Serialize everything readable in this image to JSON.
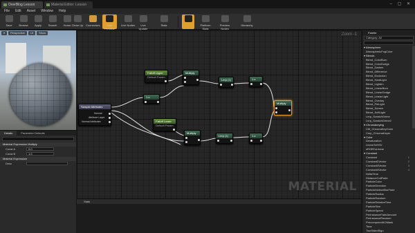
{
  "tabs": [
    {
      "label": "OverBlog Lesson"
    },
    {
      "label": "Material Editor: Lesson"
    }
  ],
  "menu": [
    "File",
    "Edit",
    "Asset",
    "Window",
    "Help"
  ],
  "toolbar": [
    {
      "label": "Save",
      "icon": "save-icon"
    },
    {
      "label": "Browse",
      "icon": "browse-icon"
    },
    {
      "label": "Apply",
      "icon": "apply-icon"
    },
    {
      "label": "Search",
      "icon": "search-icon"
    },
    {
      "label": "Home",
      "icon": "home-icon"
    },
    {
      "label": "Clean Up",
      "icon": "clean-up-icon"
    },
    {
      "label": "Connectors",
      "icon": "connectors-icon"
    },
    {
      "label": "Live Preview",
      "icon": "live-preview-icon"
    },
    {
      "label": "Live Nodes",
      "icon": "live-nodes-icon"
    },
    {
      "label": "Live Update",
      "icon": "live-update-icon"
    },
    {
      "label": "Stats",
      "icon": "stats-icon"
    },
    {
      "label": "Platform Stats",
      "icon": "platform-stats-icon"
    },
    {
      "label": "Preview Nodes",
      "icon": "preview-nodes-icon"
    },
    {
      "label": "Hierarchy",
      "icon": "hierarchy-icon"
    }
  ],
  "viewport": {
    "buttons": [
      "Perspective",
      "Lit",
      "Show"
    ]
  },
  "details": {
    "tabs": [
      "Details",
      "Parameter Defaults"
    ],
    "sections": [
      {
        "title": "Material Expression Multiply",
        "rows": [
          {
            "label": "Const A",
            "value": "0.0"
          },
          {
            "label": "Const B",
            "value": "1.0"
          }
        ]
      },
      {
        "title": "Material Expression",
        "rows": [
          {
            "label": "Desc",
            "value": ""
          }
        ]
      }
    ]
  },
  "graph": {
    "zoom": "Zoom -1",
    "watermark": "MATERIAL",
    "nodes": {
      "texcoord": {
        "title": "Sample Attributes",
        "pins": [
          "Normal",
          "Attribute Layer",
          "Normal Attributes"
        ]
      },
      "falloff_upper": {
        "title": "Falloff Upper",
        "sub": "Default Param"
      },
      "falloff_lower": {
        "title": "Falloff Lower",
        "sub": "Default Param"
      },
      "mult1": {
        "title": "Multiply"
      },
      "mult2": {
        "title": "Multiply"
      },
      "power1": {
        "title": "Lerp (1)"
      },
      "power2": {
        "title": "Lerp (1)"
      },
      "clamp1": {
        "title": "1-x"
      },
      "clamp2": {
        "title": "1-x"
      },
      "comp": {
        "title": "1-x"
      },
      "final": {
        "title": "Multiply"
      }
    }
  },
  "stats": {
    "title": "Stats"
  },
  "palette": {
    "tab": "Palette",
    "category": "Category: All",
    "items": [
      {
        "label": "Atmosphere",
        "cat": true
      },
      {
        "label": "AtmosphericFogColor"
      },
      {
        "label": "Blends",
        "cat": true
      },
      {
        "label": "Blend_ColorBurn"
      },
      {
        "label": "Blend_ColorDodge"
      },
      {
        "label": "Blend_Darken"
      },
      {
        "label": "Blend_Difference"
      },
      {
        "label": "Blend_Exclusion"
      },
      {
        "label": "Blend_HardLight"
      },
      {
        "label": "Blend_Lighten"
      },
      {
        "label": "Blend_LinearBurn"
      },
      {
        "label": "Blend_LinearDodge"
      },
      {
        "label": "Blend_LinearLight"
      },
      {
        "label": "Blend_Overlay"
      },
      {
        "label": "Blend_PinLight"
      },
      {
        "label": "Blend_Screen"
      },
      {
        "label": "Blend_SoftLight"
      },
      {
        "label": "Lerp_ScratchGrime"
      },
      {
        "label": "Lerp_ScratchGrime2"
      },
      {
        "label": "Chromakeying",
        "cat": true
      },
      {
        "label": "CM_ChromaKeyColor"
      },
      {
        "label": "Cmp_ChromaKeyer"
      },
      {
        "label": "Color",
        "cat": true
      },
      {
        "label": "Desaturation"
      },
      {
        "label": "LinearToHSV"
      },
      {
        "label": "sRGBToLinear"
      },
      {
        "label": "Constant",
        "cat": true
      },
      {
        "label": "Constant",
        "hk": "1"
      },
      {
        "label": "Constant2Vector",
        "hk": "2"
      },
      {
        "label": "Constant3Vector",
        "hk": "3"
      },
      {
        "label": "Constant4Vector",
        "hk": "4"
      },
      {
        "label": "DeltaTime"
      },
      {
        "label": "DistanceCullFade"
      },
      {
        "label": "ParticleColor"
      },
      {
        "label": "ParticleDirection"
      },
      {
        "label": "ParticleMotionBlurFade"
      },
      {
        "label": "ParticleRadius"
      },
      {
        "label": "ParticleRandom"
      },
      {
        "label": "ParticleRelativeTime"
      },
      {
        "label": "ParticleSize"
      },
      {
        "label": "ParticleSpeed"
      },
      {
        "label": "PerInstanceFadeAmount"
      },
      {
        "label": "PerInstanceRandom"
      },
      {
        "label": "PrecomputedAOMask"
      },
      {
        "label": "Time"
      },
      {
        "label": "TwoSidedSign"
      }
    ]
  }
}
